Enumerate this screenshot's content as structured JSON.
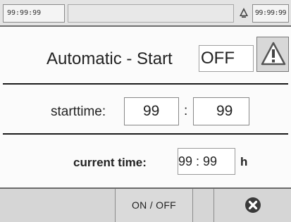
{
  "status_bar": {
    "left_time": "99:99:99",
    "right_time": "99:99:99",
    "alarm_icon": "alarm-bell-icon"
  },
  "auto_start": {
    "title": "Automatic - Start",
    "state": "OFF",
    "warning_icon": "warning-triangle-icon"
  },
  "start_time": {
    "label": "starttime:",
    "hours": "99",
    "separator": ":",
    "minutes": "99"
  },
  "current_time": {
    "label": "current time:",
    "value": "99 : 99",
    "unit": "h"
  },
  "softkeys": {
    "on_off_label": "ON / OFF",
    "close_icon": "close-icon"
  },
  "colors": {
    "background": "#fbfbfb",
    "bar": "#d6d6d6",
    "divider": "#1b1b1b",
    "text": "#222222"
  }
}
